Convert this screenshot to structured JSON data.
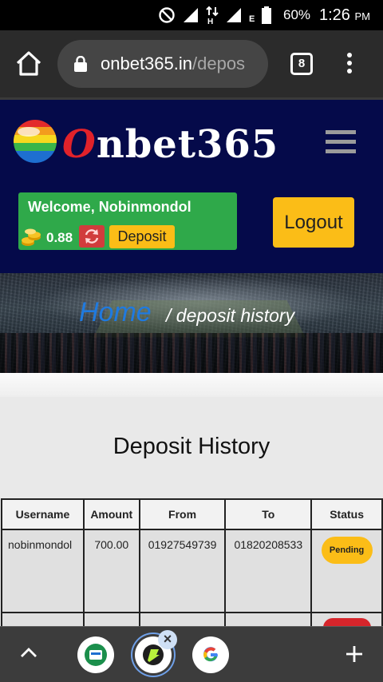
{
  "status_bar": {
    "battery": "60%",
    "time": "1:26",
    "ampm": "PM",
    "network": "E"
  },
  "browser": {
    "url_main": "onbet365.in",
    "url_path": "/depos",
    "tab_count": "8"
  },
  "site": {
    "logo_first": "O",
    "logo_rest": "nbet365",
    "welcome": "Welcome, Nobinmondol",
    "balance": "0.88",
    "deposit_label": "Deposit",
    "logout_label": "Logout"
  },
  "breadcrumb": {
    "home": "Home",
    "current": "/ deposit history"
  },
  "page_title": "Deposit History",
  "table": {
    "headers": [
      "Username",
      "Amount",
      "From",
      "To",
      "Status"
    ],
    "rows": [
      {
        "username": "nobinmondol",
        "amount": "700.00",
        "from": "01927549739",
        "to": "01820208533",
        "status": "Pending"
      }
    ]
  },
  "colors": {
    "header_bg": "#050a4a",
    "accent_yellow": "#fbbd17",
    "welcome_green": "#2fa94a",
    "breadcrumb_blue": "#1f7ae0",
    "danger_red": "#d13c3c"
  }
}
